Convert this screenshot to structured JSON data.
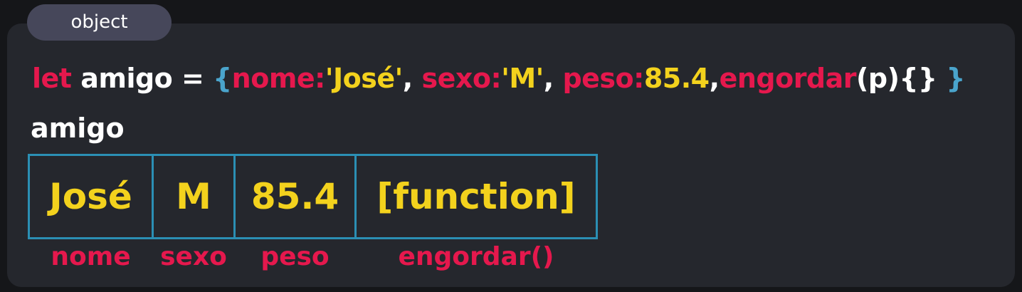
{
  "badge": "object",
  "code": {
    "keyword": "let",
    "var_name": "amigo",
    "equals": "=",
    "open_brace": "{",
    "close_brace": "}",
    "props": [
      {
        "key": "nome:",
        "value": "'José'"
      },
      {
        "key": "sexo:",
        "value": "'M'"
      },
      {
        "key": "peso:",
        "value": "85.4"
      }
    ],
    "method_name": "engordar",
    "method_rest": "(p){}"
  },
  "object_label": "amigo",
  "cells": [
    {
      "value": "José",
      "label": "nome"
    },
    {
      "value": "M",
      "label": "sexo"
    },
    {
      "value": "85.4",
      "label": "peso"
    },
    {
      "value": "[function]",
      "label": "engordar()"
    }
  ],
  "colors": {
    "keyword": "#e5184d",
    "value": "#f3d21d",
    "brace": "#4aa4cc",
    "cell_border": "#2b8fb4"
  }
}
